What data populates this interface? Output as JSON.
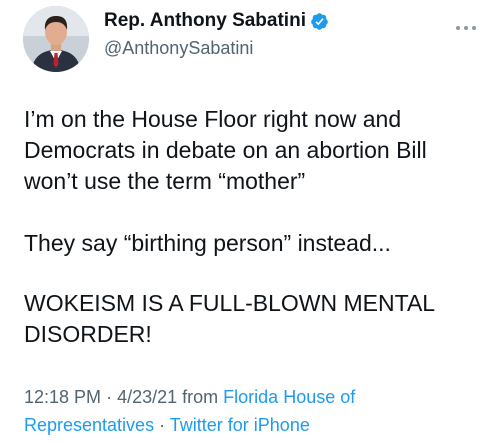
{
  "user": {
    "display_name": "Rep. Anthony Sabatini",
    "handle": "@AnthonySabatini",
    "verified": true
  },
  "tweet": {
    "paragraphs": [
      "I’m on the House Floor right now and Democrats in debate on an abortion Bill won’t use the term “mother”",
      "They say “birthing person” instead...",
      "WOKEISM IS A FULL-BLOWN MENTAL DISORDER!"
    ]
  },
  "meta": {
    "time": "12:18 PM",
    "separator": "·",
    "date": "4/23/21",
    "from_label": "from",
    "source": "Florida House of Representatives",
    "client": "Twitter for iPhone"
  },
  "colors": {
    "link": "#1d9bf0",
    "secondary_text": "#536471",
    "primary_text": "#0f1419",
    "verified_badge": "#1d9bf0"
  },
  "icons": {
    "verified": "verified-badge-icon",
    "more": "more-options-icon"
  }
}
